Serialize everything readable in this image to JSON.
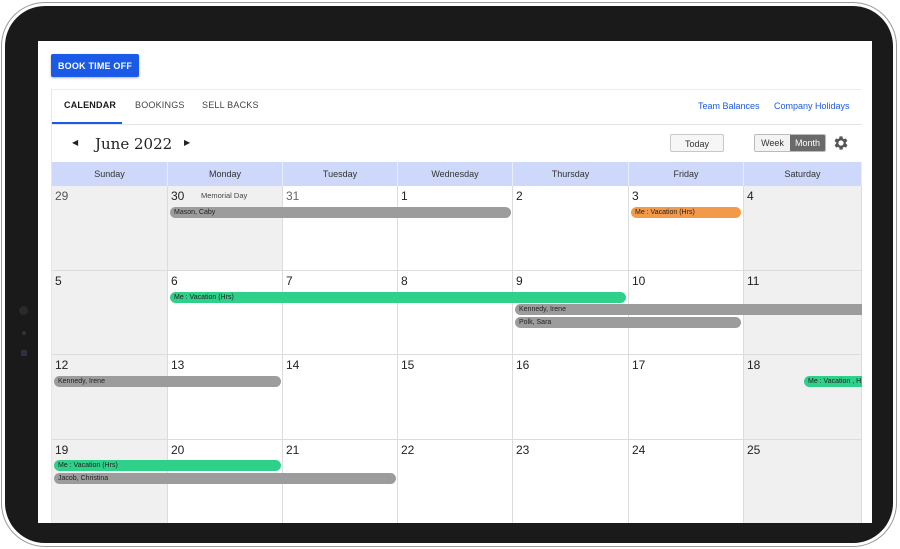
{
  "toolbar": {
    "book_time_off": "BOOK TIME OFF"
  },
  "tabs": [
    {
      "label": "CALENDAR",
      "active": true
    },
    {
      "label": "BOOKINGS",
      "active": false
    },
    {
      "label": "SELL BACKS",
      "active": false
    }
  ],
  "links": {
    "team_balances": "Team Balances",
    "company_holidays": "Company Holidays"
  },
  "nav": {
    "prev": "◀",
    "next": "▶",
    "month_title": "June 2022",
    "today": "Today"
  },
  "view_toggle": {
    "week": "Week",
    "month": "Month",
    "selected": "Month"
  },
  "days": [
    "Sunday",
    "Monday",
    "Tuesday",
    "Wednesday",
    "Thursday",
    "Friday",
    "Saturday"
  ],
  "weeks": [
    [
      "29",
      "30",
      "31",
      "1",
      "2",
      "3",
      "4"
    ],
    [
      "5",
      "6",
      "7",
      "8",
      "9",
      "10",
      "11"
    ],
    [
      "12",
      "13",
      "14",
      "15",
      "16",
      "17",
      "18"
    ],
    [
      "19",
      "20",
      "21",
      "22",
      "23",
      "24",
      "25"
    ]
  ],
  "holiday": "Memorial Day",
  "events": {
    "mason_caby": "Mason, Caby",
    "me_vacation_w1": "Me : Vacation (Hrs)",
    "me_vacation_w2": "Me : Vacation (Hrs)",
    "kennedy_irene_w2": "Kennedy, Irene",
    "polk_sara": "Polk, Sara",
    "kennedy_irene_w3": "Kennedy, Irene",
    "me_vacation_w3": "Me : Vacation , H",
    "me_vacation_w4": "Me : Vacation (Hrs)",
    "jacob_christina": "Jacob, Christina"
  },
  "colors": {
    "accent": "#1a5ae6",
    "header_bg": "#cdd8fa",
    "green": "#2fd08a",
    "orange": "#f29a4a",
    "gray": "#9c9c9c"
  }
}
